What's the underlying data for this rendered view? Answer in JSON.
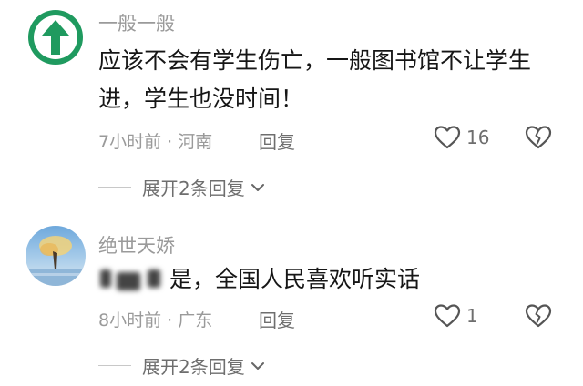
{
  "comments": [
    {
      "username": "一般一般",
      "text": "应该不会有学生伤亡，一般图书馆不让学生进，学生也没时间！",
      "time": "7小时前",
      "location": "河南",
      "reply_label": "回复",
      "like_count": "16",
      "expand_label": "展开2条回复",
      "avatar_icon": "green-up-arrow-icon",
      "avatar_color": "#1f9a5f"
    },
    {
      "username": "绝世天娇",
      "text_visible": "是，全国人民喜欢听实话",
      "time": "8小时前",
      "location": "广东",
      "reply_label": "回复",
      "like_count": "1",
      "expand_label": "展开2条回复",
      "avatar_icon": "landscape-photo-avatar"
    }
  ],
  "separator": " · ",
  "icons": {
    "like": "heart-outline-icon",
    "dislike": "broken-heart-icon",
    "expand": "chevron-down-icon"
  },
  "colors": {
    "secondary_text": "#9a9a9a",
    "action_text": "#6e6e6e"
  }
}
